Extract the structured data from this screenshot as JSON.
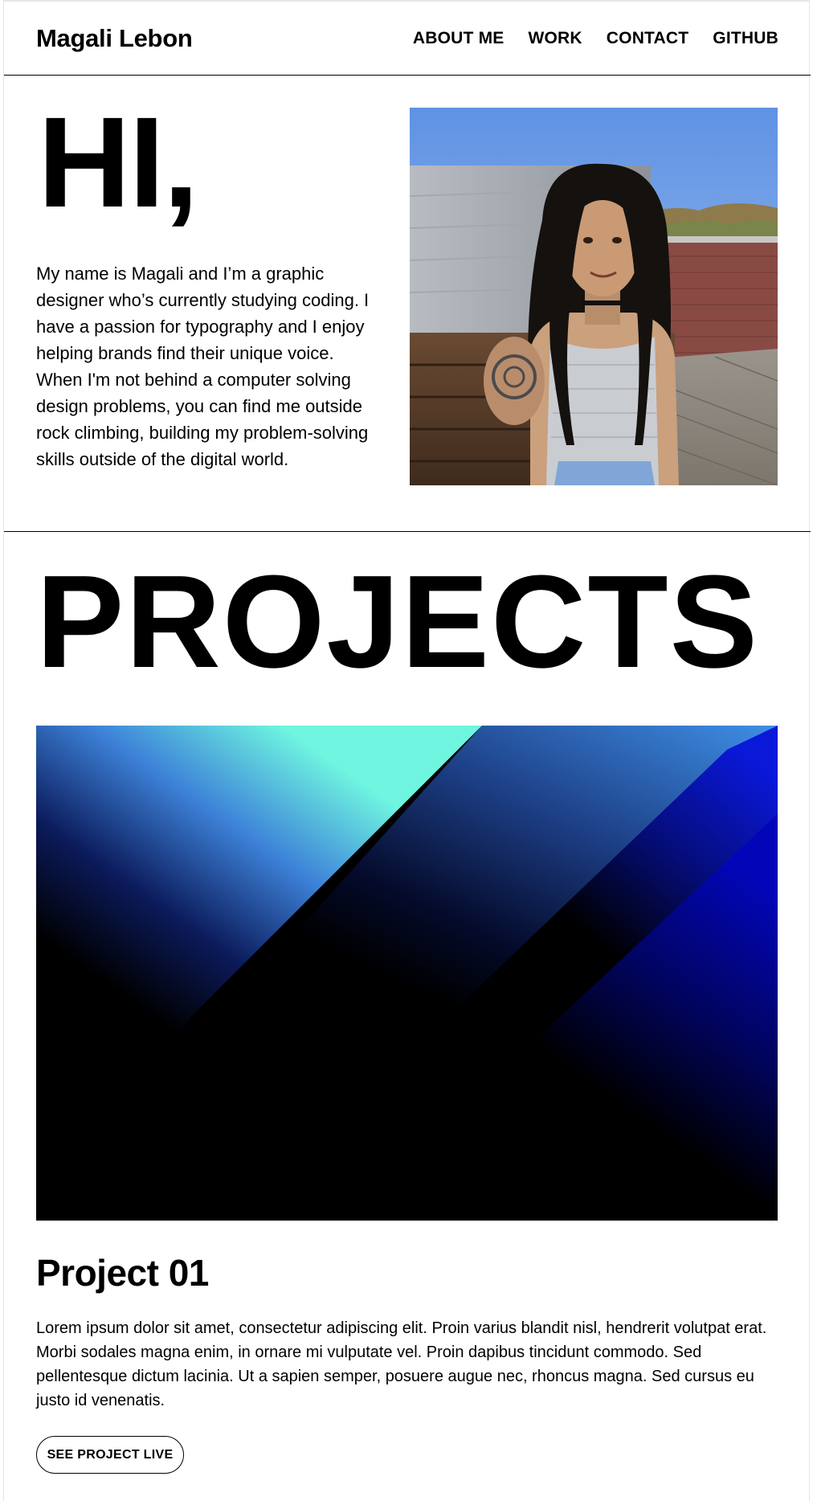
{
  "header": {
    "logo": "Magali Lebon",
    "nav": [
      "ABOUT ME",
      "WORK",
      "CONTACT",
      "GITHUB"
    ]
  },
  "hero": {
    "greeting": "HI,",
    "bio": "My name is Magali and I’m a graphic designer who’s currently studying coding. I have a passion for typography and I enjoy helping brands find their unique voice. When I'm not behind a computer solving design problems, you can find me outside rock climbing, building my problem-solving skills outside of the digital world."
  },
  "projects": {
    "heading": "PROJECTS",
    "items": [
      {
        "title": "Project 01",
        "description": "Lorem ipsum dolor sit amet, consectetur adipiscing elit. Proin varius blandit nisl, hendrerit volutpat erat. Morbi sodales magna enim, in ornare mi vulputate vel. Proin dapibus tincidunt commodo. Sed pellentesque dictum lacinia. Ut a sapien semper, posuere augue nec, rhoncus magna. Sed cursus eu justo id venenatis.",
        "button_label": "SEE PROJECT LIVE"
      }
    ]
  },
  "colors": {
    "text": "#000000",
    "background": "#ffffff",
    "accent_blue": "#1a3ad6",
    "accent_cyan": "#6ff5e0"
  }
}
